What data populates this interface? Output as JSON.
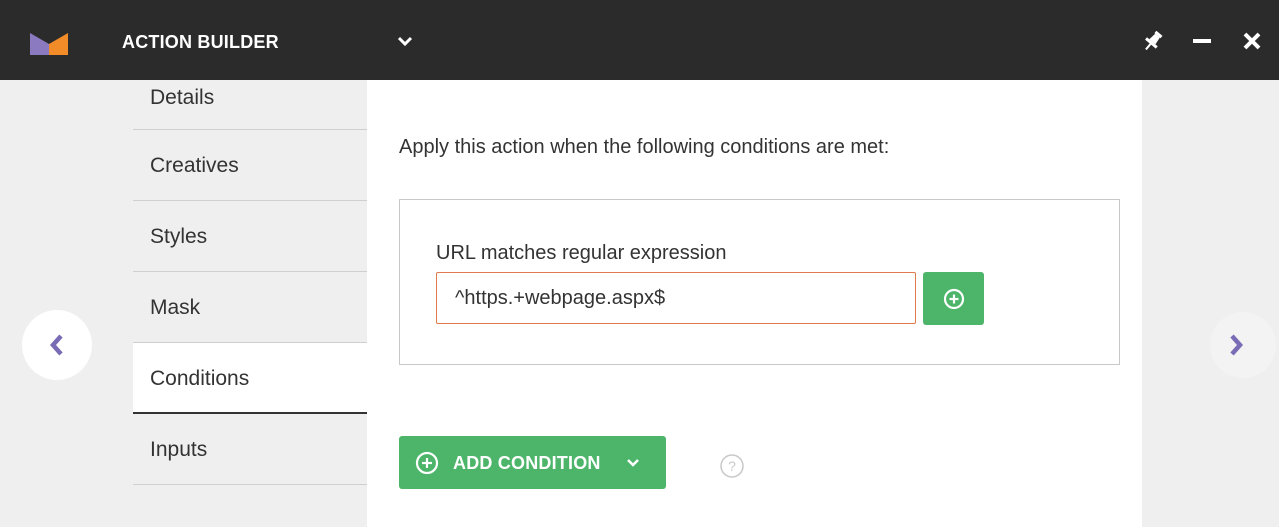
{
  "header": {
    "title": "ACTION BUILDER",
    "logo_icon": "m-logo-icon",
    "dropdown_icon": "chevron-down-icon",
    "actions": [
      "pin-icon",
      "minimize-icon",
      "close-icon"
    ]
  },
  "nav": {
    "items": [
      {
        "label": "Details",
        "active": false
      },
      {
        "label": "Creatives",
        "active": false
      },
      {
        "label": "Styles",
        "active": false
      },
      {
        "label": "Mask",
        "active": false
      },
      {
        "label": "Conditions",
        "active": true
      },
      {
        "label": "Inputs",
        "active": false
      }
    ]
  },
  "content": {
    "intro": "Apply this action when the following conditions are met:",
    "condition": {
      "label": "URL matches regular expression",
      "value": "^https.+webpage.aspx$"
    },
    "add_condition_label": "ADD CONDITION",
    "help_icon": "question-circle-icon"
  },
  "colors": {
    "header_bg": "#2b2b2b",
    "accent_green": "#4cb56a",
    "input_border": "#e07a4d",
    "arrow_purple": "#7a6bb5",
    "logo_purple": "#8c7ac0",
    "logo_orange": "#f28c28"
  }
}
